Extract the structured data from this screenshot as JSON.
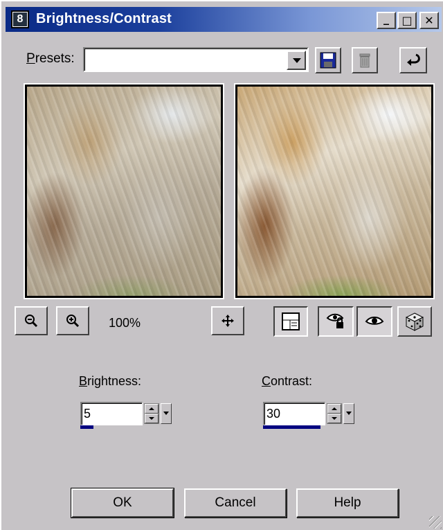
{
  "window": {
    "title": "Brightness/Contrast",
    "app_icon_label": "8",
    "controls": {
      "minimize": "_",
      "maximize": "□",
      "close": "✕"
    }
  },
  "presets": {
    "label_accel": "P",
    "label_rest": "resets:",
    "value": "",
    "icons": [
      "save-preset-icon",
      "delete-preset-icon",
      "reset-icon"
    ]
  },
  "preview": {
    "zoom_level": "100%",
    "zoom_out_glyph": "🔍−",
    "zoom_in_glyph": "🔍+",
    "pan_glyph": "✥"
  },
  "brightness": {
    "label_accel": "B",
    "label_rest": "rightness:",
    "value": "5",
    "level": 0.27
  },
  "contrast": {
    "label_accel": "C",
    "label_rest": "ontrast:",
    "value": "30",
    "level": 0.65
  },
  "buttons": {
    "ok": "OK",
    "cancel": "Cancel",
    "help": "Help"
  },
  "colors": {
    "titlebar_start": "#0a2a86",
    "titlebar_end": "#b5c8ea",
    "face": "#c6c3c6",
    "bar": "#000080"
  }
}
